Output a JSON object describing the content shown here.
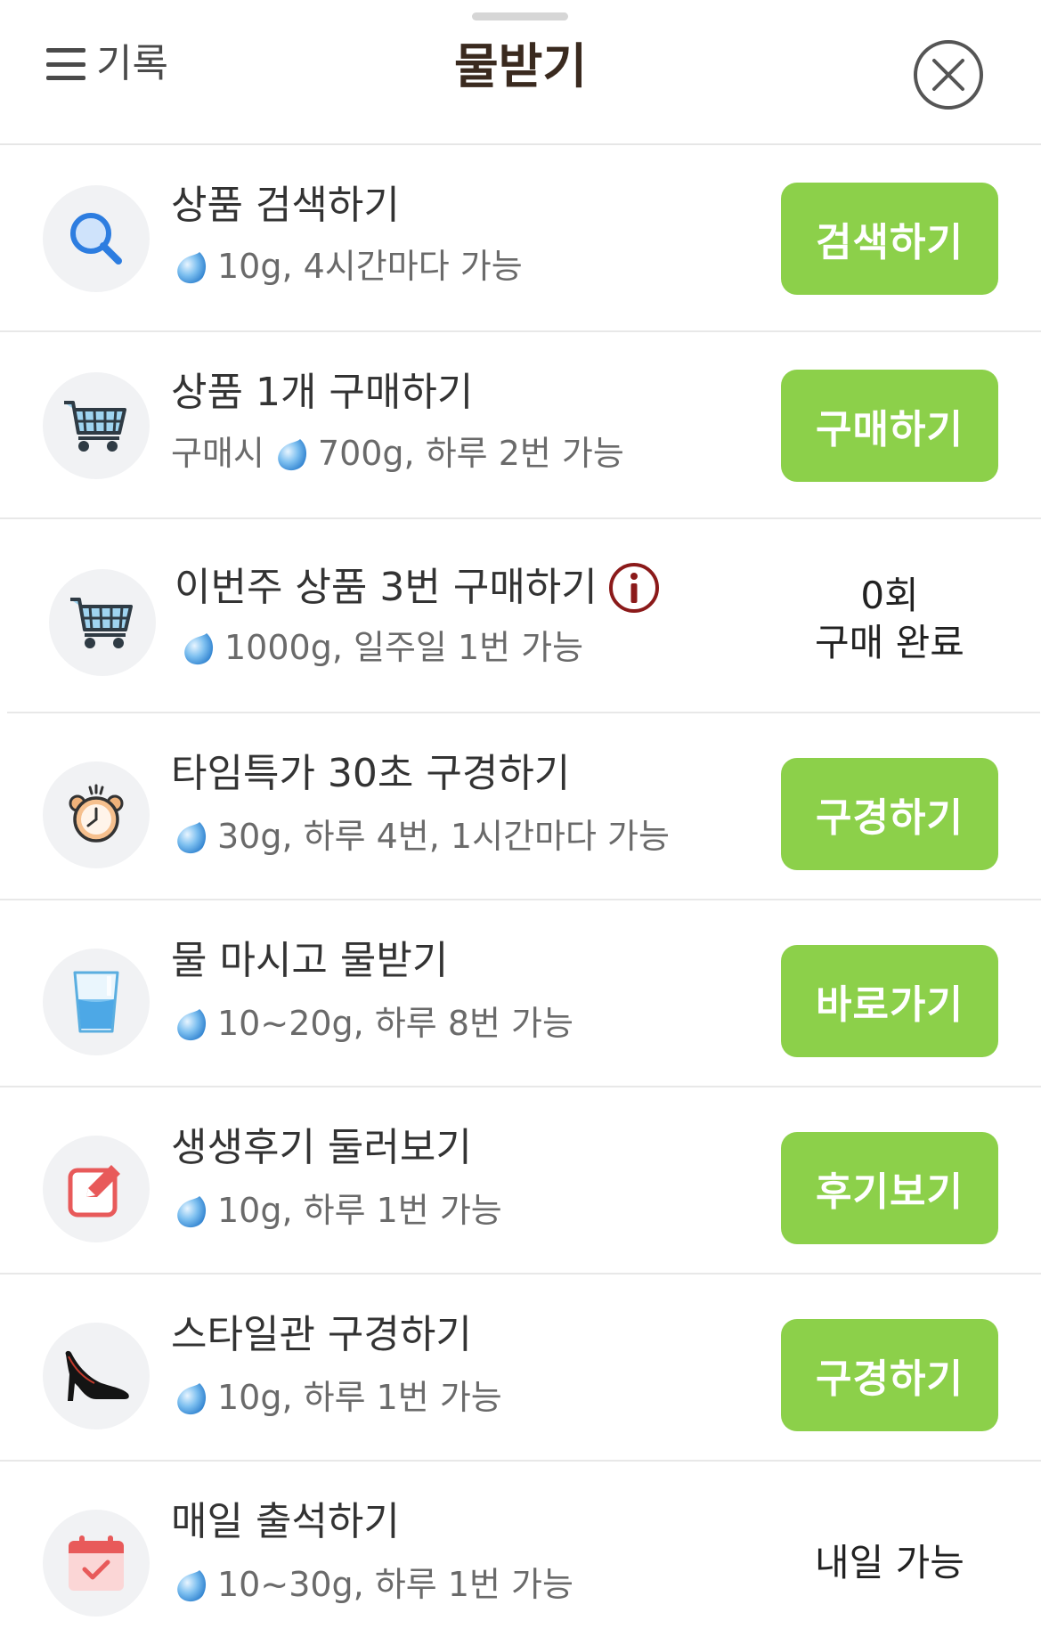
{
  "header": {
    "history_label": "기록",
    "title": "물받기"
  },
  "colors": {
    "button_green": "#8cd04a",
    "title_brown": "#3a2a1f",
    "info_red": "#8b1a1a"
  },
  "items": [
    {
      "icon": "search-icon",
      "title": "상품 검색하기",
      "sub_prefix": "",
      "sub": "10g, 4시간마다 가능",
      "button": "검색하기"
    },
    {
      "icon": "cart-icon",
      "title": "상품 1개 구매하기",
      "sub_prefix": "구매시",
      "sub": "700g, 하루 2번 가능",
      "button": "구매하기"
    },
    {
      "icon": "cart-icon",
      "title": "이번주 상품 3번 구매하기",
      "sub_prefix": "",
      "sub": "1000g, 일주일 1번 가능",
      "status_line1": "0회",
      "status_line2": "구매 완료"
    },
    {
      "icon": "alarm-clock-icon",
      "title": "타임특가 30초 구경하기",
      "sub_prefix": "",
      "sub": "30g, 하루 4번, 1시간마다 가능",
      "button": "구경하기"
    },
    {
      "icon": "water-glass-icon",
      "title": "물 마시고 물받기",
      "sub_prefix": "",
      "sub": "10~20g, 하루 8번 가능",
      "button": "바로가기"
    },
    {
      "icon": "edit-icon",
      "title": "생생후기 둘러보기",
      "sub_prefix": "",
      "sub": "10g, 하루 1번 가능",
      "button": "후기보기"
    },
    {
      "icon": "high-heel-icon",
      "title": "스타일관 구경하기",
      "sub_prefix": "",
      "sub": "10g, 하루 1번 가능",
      "button": "구경하기"
    },
    {
      "icon": "calendar-check-icon",
      "title": "매일 출석하기",
      "sub_prefix": "",
      "sub": "10~30g, 하루 1번 가능",
      "status": "내일 가능"
    }
  ]
}
